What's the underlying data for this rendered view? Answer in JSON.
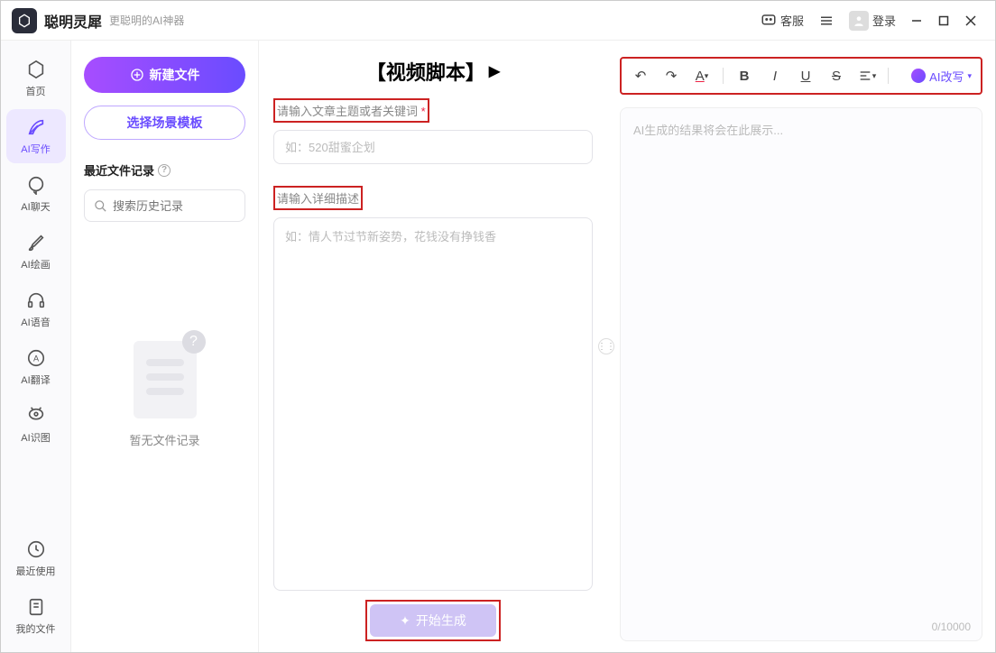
{
  "titlebar": {
    "app_name": "聪明灵犀",
    "app_sub": "更聪明的AI神器",
    "support": "客服",
    "login": "登录"
  },
  "sidebar": {
    "items": [
      {
        "label": "首页",
        "icon": "home"
      },
      {
        "label": "AI写作",
        "icon": "feather",
        "active": true
      },
      {
        "label": "AI聊天",
        "icon": "chat"
      },
      {
        "label": "AI绘画",
        "icon": "brush"
      },
      {
        "label": "AI语音",
        "icon": "headphone"
      },
      {
        "label": "AI翻译",
        "icon": "translate"
      },
      {
        "label": "AI识图",
        "icon": "camera"
      },
      {
        "label": "最近使用",
        "icon": "clock"
      },
      {
        "label": "我的文件",
        "icon": "file"
      }
    ]
  },
  "left_panel": {
    "new_file": "新建文件",
    "choose_template": "选择场景模板",
    "recent_label": "最近文件记录",
    "search_placeholder": "搜索历史记录",
    "empty_text": "暂无文件记录"
  },
  "mid_panel": {
    "title": "【视频脚本】",
    "label1": "请输入文章主题或者关键词",
    "required": "*",
    "placeholder1": "如：520甜蜜企划",
    "label2": "请输入详细描述",
    "placeholder2": "如：情人节过节新姿势，花钱没有挣钱香",
    "generate": "开始生成"
  },
  "right_panel": {
    "ai_rewrite": "AI改写",
    "output_placeholder": "AI生成的结果将会在此展示...",
    "char_count": "0/10000"
  }
}
